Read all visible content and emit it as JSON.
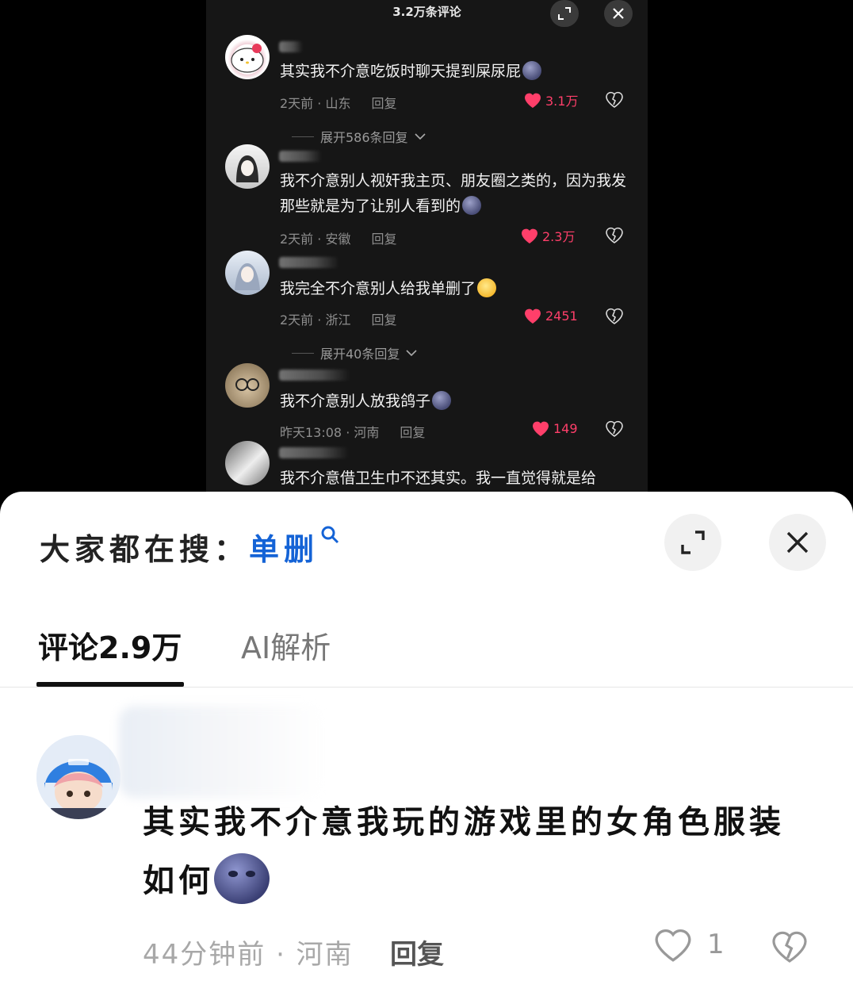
{
  "video": {
    "title": "3.2万条评论",
    "comments": [
      {
        "time": "2天前 · 山东",
        "reply": "回复",
        "text": "其实我不介意吃饭时聊天提到屎尿屁",
        "likes": "3.1万",
        "expand": null
      },
      {
        "time": "",
        "reply": "",
        "text": "",
        "likes": "",
        "expand": "展开586条回复"
      },
      {
        "time": "2天前 · 安徽",
        "reply": "回复",
        "text": "我不介意别人视奸我主页、朋友圈之类的，因为我发那些就是为了让别人看到的",
        "likes": "2.3万"
      },
      {
        "time": "2天前 · 浙江",
        "reply": "回复",
        "text": "我完全不介意别人给我单删了",
        "likes": "2451"
      },
      {
        "expand": "展开40条回复"
      },
      {
        "time": "昨天13:08 · 河南",
        "reply": "回复",
        "text": "我不介意别人放我鸽子",
        "likes": "149"
      },
      {
        "text": "我不介意借卫生巾不还其实。我一直觉得就是给"
      }
    ]
  },
  "sheet": {
    "search_prefix": "大家都在搜：",
    "search_term": "单删",
    "tabs": {
      "comments": "评论2.9万",
      "ai": "AI解析"
    },
    "comment": {
      "text": "其实我不介意我玩的游戏里的女角色服装如何",
      "time": "44分钟前 · 河南",
      "reply": "回复",
      "likes": "1"
    }
  }
}
